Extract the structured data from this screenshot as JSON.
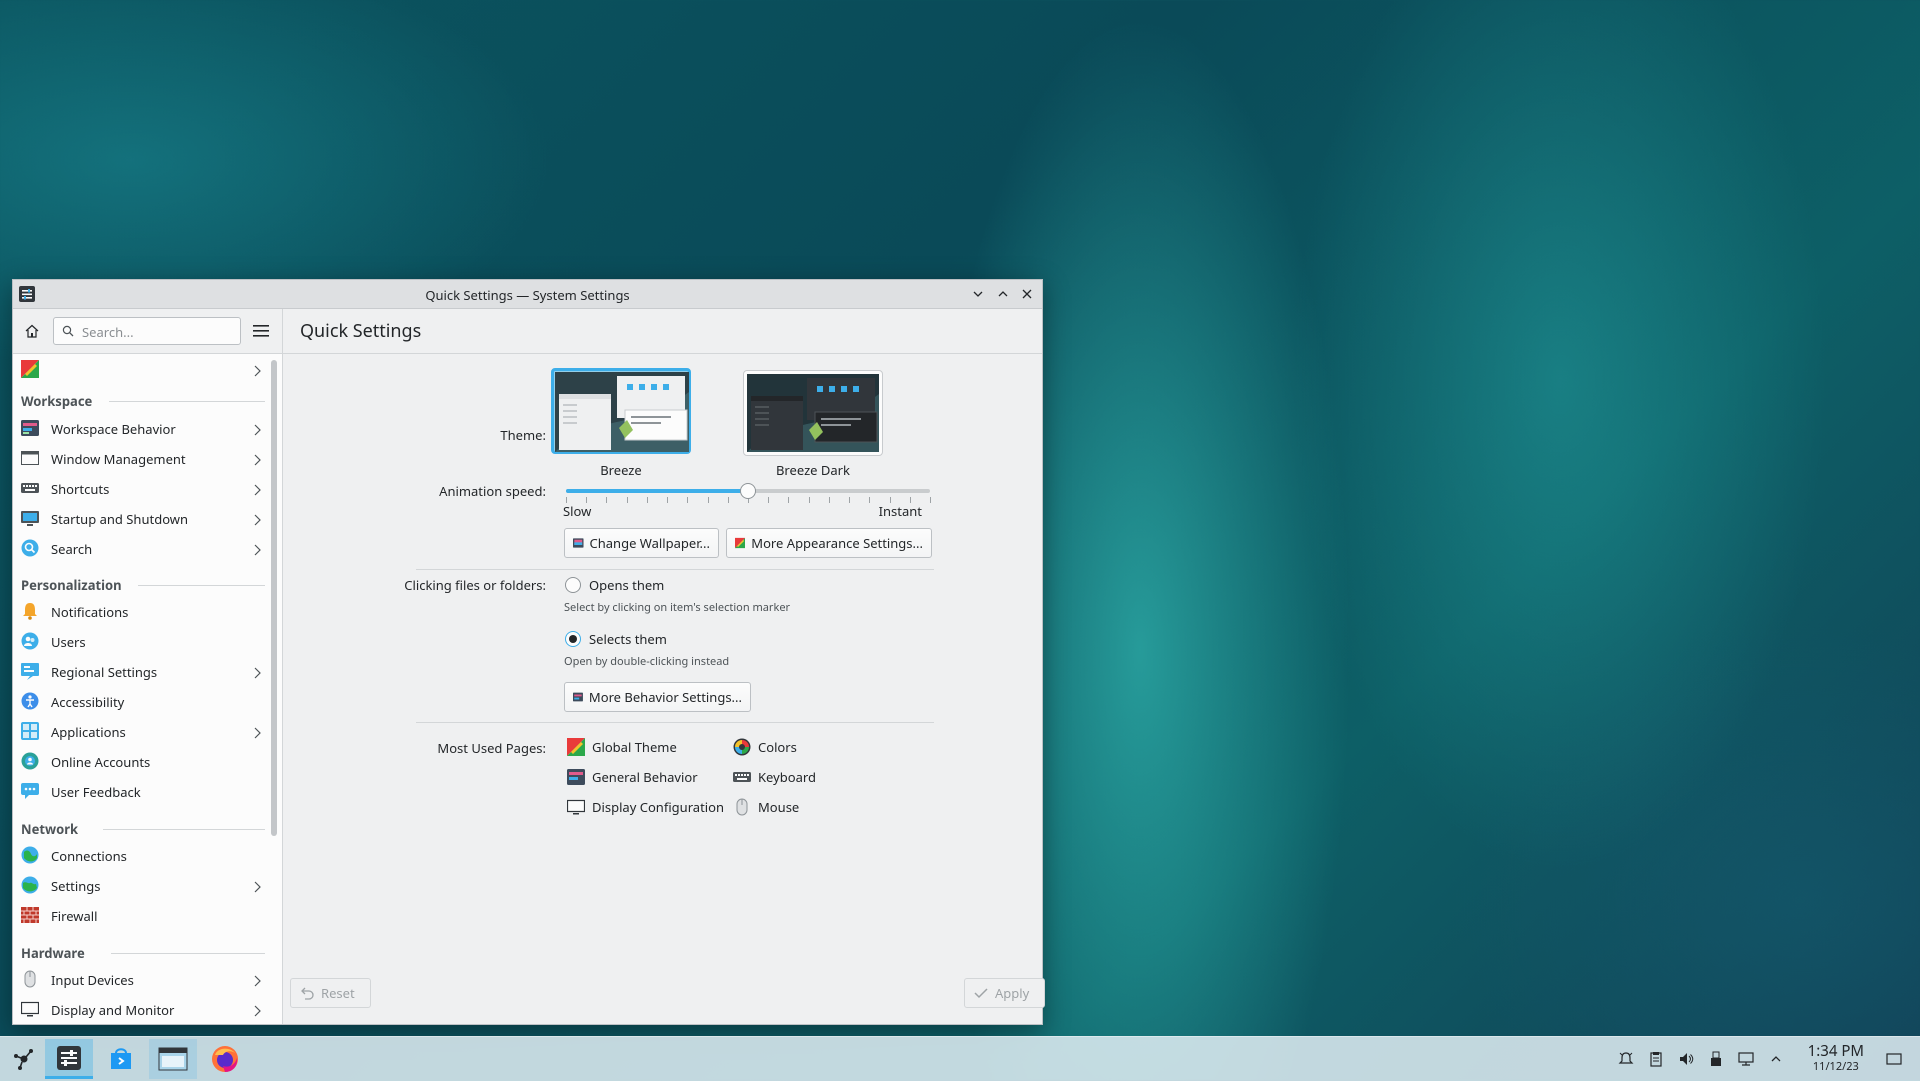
{
  "window": {
    "title": "Quick Settings — System Settings"
  },
  "toolbar": {
    "search_placeholder": "Search...",
    "page_title": "Quick Settings"
  },
  "sidebar": {
    "sections": [
      {
        "title": "Workspace",
        "items": [
          {
            "label": "Workspace Behavior",
            "icon": "workspace-behavior-icon",
            "has_children": true
          },
          {
            "label": "Window Management",
            "icon": "window-management-icon",
            "has_children": true
          },
          {
            "label": "Shortcuts",
            "icon": "keyboard-icon",
            "has_children": true
          },
          {
            "label": "Startup and Shutdown",
            "icon": "startup-icon",
            "has_children": true
          },
          {
            "label": "Search",
            "icon": "search-globe-icon",
            "has_children": true
          }
        ]
      },
      {
        "title": "Personalization",
        "items": [
          {
            "label": "Notifications",
            "icon": "bell-icon",
            "has_children": false
          },
          {
            "label": "Users",
            "icon": "users-icon",
            "has_children": false
          },
          {
            "label": "Regional Settings",
            "icon": "regional-icon",
            "has_children": true
          },
          {
            "label": "Accessibility",
            "icon": "accessibility-icon",
            "has_children": false
          },
          {
            "label": "Applications",
            "icon": "applications-icon",
            "has_children": true
          },
          {
            "label": "Online Accounts",
            "icon": "online-accounts-icon",
            "has_children": false
          },
          {
            "label": "User Feedback",
            "icon": "feedback-icon",
            "has_children": false
          }
        ]
      },
      {
        "title": "Network",
        "items": [
          {
            "label": "Connections",
            "icon": "connections-icon",
            "has_children": false
          },
          {
            "label": "Settings",
            "icon": "network-settings-icon",
            "has_children": true
          },
          {
            "label": "Firewall",
            "icon": "firewall-icon",
            "has_children": false
          }
        ]
      },
      {
        "title": "Hardware",
        "items": [
          {
            "label": "Input Devices",
            "icon": "mouse-icon",
            "has_children": true
          },
          {
            "label": "Display and Monitor",
            "icon": "monitor-icon",
            "has_children": true
          }
        ]
      }
    ]
  },
  "quick_settings": {
    "theme_label": "Theme:",
    "themes": [
      {
        "name": "Breeze",
        "selected": true
      },
      {
        "name": "Breeze Dark",
        "selected": false
      }
    ],
    "animation_label": "Animation speed:",
    "animation_slow": "Slow",
    "animation_instant": "Instant",
    "animation_value_fraction": 0.5,
    "change_wallpaper": "Change Wallpaper...",
    "more_appearance": "More Appearance Settings...",
    "clicking_label": "Clicking files or folders:",
    "click_options": [
      {
        "label": "Opens them",
        "desc": "Select by clicking on item's selection marker",
        "checked": false
      },
      {
        "label": "Selects them",
        "desc": "Open by double-clicking instead",
        "checked": true
      }
    ],
    "more_behavior": "More Behavior Settings...",
    "most_used_label": "Most Used Pages:",
    "most_used": [
      {
        "label": "Global Theme",
        "icon": "global-theme-icon"
      },
      {
        "label": "Colors",
        "icon": "colors-icon"
      },
      {
        "label": "General Behavior",
        "icon": "general-behavior-icon"
      },
      {
        "label": "Keyboard",
        "icon": "keyboard-icon"
      },
      {
        "label": "Display Configuration",
        "icon": "display-icon"
      },
      {
        "label": "Mouse",
        "icon": "mouse-icon"
      }
    ]
  },
  "footer": {
    "reset": "Reset",
    "apply": "Apply"
  },
  "taskbar": {
    "time": "1:34 PM",
    "date": "11/12/23"
  },
  "colors": {
    "accent": "#3daee9",
    "window_bg": "#eff0f1",
    "sidebar_bg": "#fcfcfc"
  }
}
